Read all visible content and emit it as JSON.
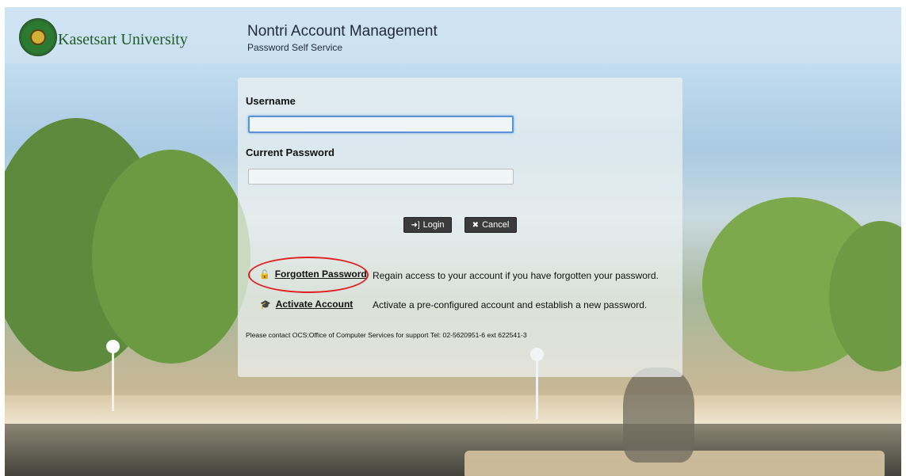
{
  "header": {
    "university_name": "Kasetsart University",
    "app_title": "Nontri Account Management",
    "app_subtitle": "Password Self Service",
    "logo_icon": "university-seal-icon"
  },
  "form": {
    "username_label": "Username",
    "username_value": "",
    "password_label": "Current Password",
    "password_value": "",
    "login_label": "Login",
    "cancel_label": "Cancel",
    "login_icon": "sign-in-icon",
    "cancel_icon": "close-icon"
  },
  "links": [
    {
      "icon": "unlock-icon",
      "label": "Forgotten Password",
      "description": "Regain access to your account if you have forgotten your password."
    },
    {
      "icon": "graduation-cap-icon",
      "label": "Activate Account",
      "description": "Activate a pre-configured account and establish a new password."
    }
  ],
  "contact": "Please contact OCS:Office of Computer Services for support Tel: 02-5620951-6 ext 622541-3",
  "colors": {
    "highlight_oval": "#e02020",
    "focus_border": "#5a93d8",
    "button_bg": "#3b3b3b"
  }
}
